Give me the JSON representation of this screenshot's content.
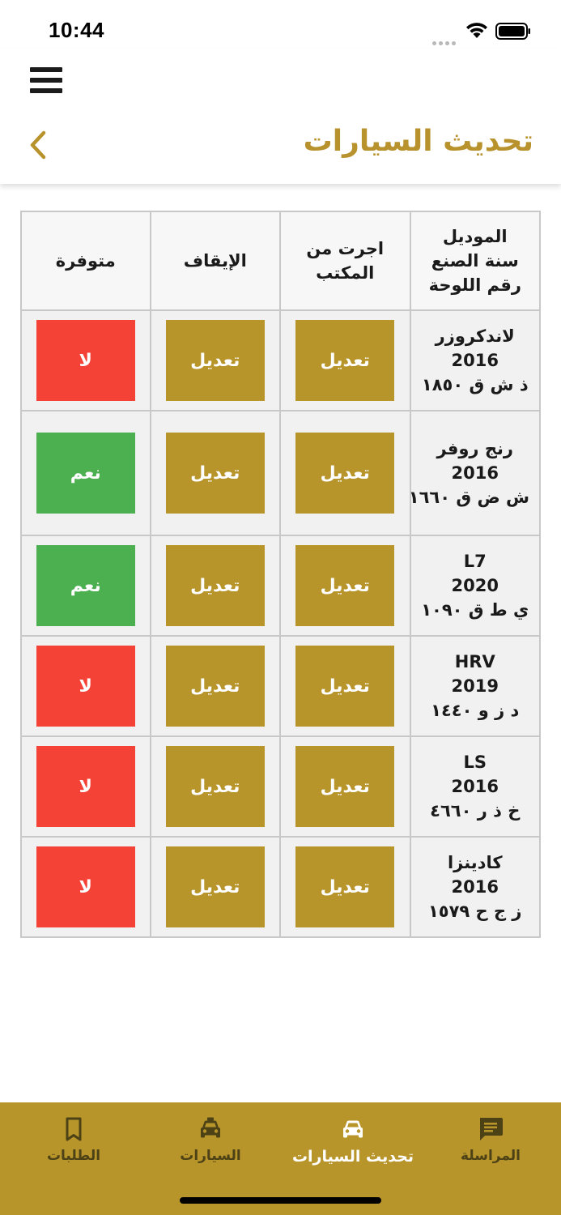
{
  "status_bar": {
    "time": "10:44"
  },
  "header": {
    "title": "تحديث السيارات"
  },
  "table": {
    "headers": {
      "model": [
        "الموديل",
        "سنة الصنع",
        "رقم اللوحة"
      ],
      "rented_from_office": [
        "اجرت من",
        "المكتب"
      ],
      "suspension": "الإيقاف",
      "available": "متوفرة"
    },
    "rows": [
      {
        "model": "لاندكروزر",
        "year": "2016",
        "plate": "ذ ش ق ١٨٥٠",
        "office_btn": "تعديل",
        "suspend_btn": "تعديل",
        "available": "لا",
        "available_color": "#f44336"
      },
      {
        "model": "رنج روفر",
        "year": "2016",
        "plate": "ش ض ق ١٦٦٠",
        "office_btn": "تعديل",
        "suspend_btn": "تعديل",
        "available": "نعم",
        "available_color": "#4caf50"
      },
      {
        "model": "L7",
        "year": "2020",
        "plate": "ي ط ق ١٠٩٠",
        "office_btn": "تعديل",
        "suspend_btn": "تعديل",
        "available": "نعم",
        "available_color": "#4caf50"
      },
      {
        "model": "HRV",
        "year": "2019",
        "plate": "د ز و ١٤٤٠",
        "office_btn": "تعديل",
        "suspend_btn": "تعديل",
        "available": "لا",
        "available_color": "#f44336"
      },
      {
        "model": "LS",
        "year": "2016",
        "plate": "خ ذ ر ٤٦٦٠",
        "office_btn": "تعديل",
        "suspend_btn": "تعديل",
        "available": "لا",
        "available_color": "#f44336"
      },
      {
        "model": "كادينزا",
        "year": "2016",
        "plate": "ز ج ح ١٥٧٩",
        "office_btn": "تعديل",
        "suspend_btn": "تعديل",
        "available": "لا",
        "available_color": "#f44336"
      }
    ]
  },
  "bottom_nav": {
    "items": [
      {
        "label": "المراسلة",
        "icon": "chat-icon",
        "active": false
      },
      {
        "label": "تحديث السيارات",
        "icon": "car-icon",
        "active": true
      },
      {
        "label": "السيارات",
        "icon": "taxi-icon",
        "active": false
      },
      {
        "label": "الطلبات",
        "icon": "bookmark-icon",
        "active": false
      }
    ]
  },
  "colors": {
    "accent": "#b8952b",
    "title": "#b8922c",
    "yes": "#4caf50",
    "no": "#f44336"
  }
}
